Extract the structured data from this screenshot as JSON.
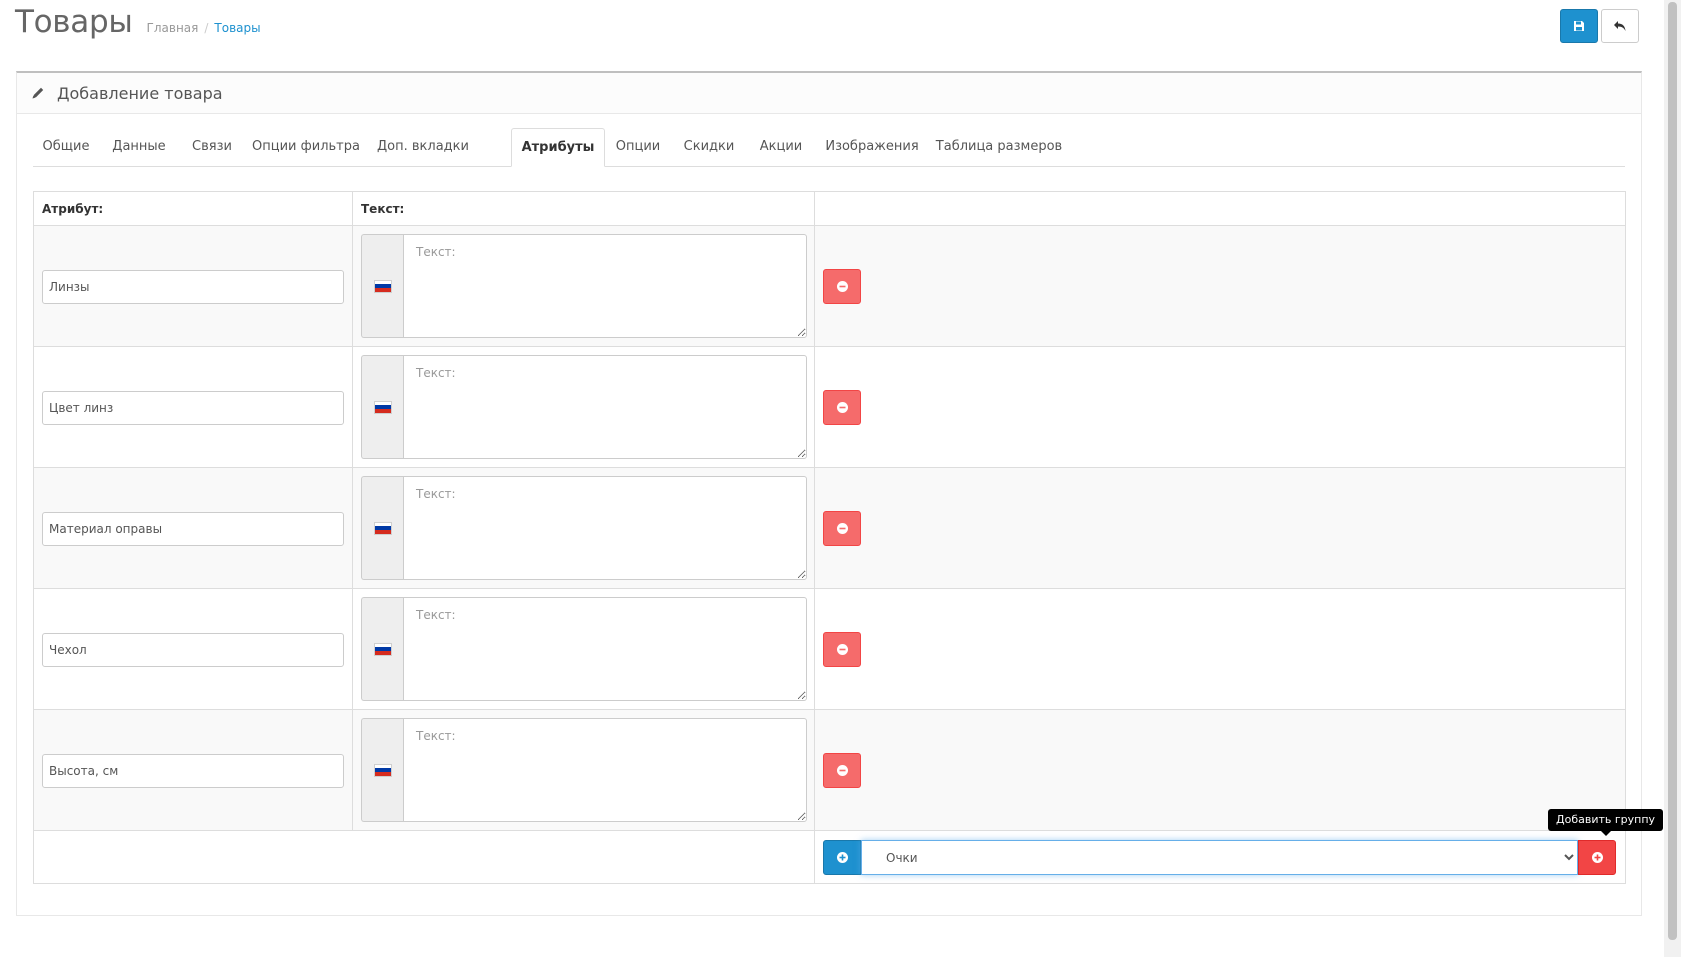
{
  "header": {
    "title": "Товары",
    "breadcrumb": [
      "Главная",
      "Товары"
    ]
  },
  "panel": {
    "title": "Добавление товара"
  },
  "tabs": [
    "Общие",
    "Данные",
    "Связи",
    "Опции фильтра",
    "Доп. вкладки",
    "Атрибуты",
    "Опции",
    "Скидки",
    "Акции",
    "Изображения",
    "Таблица размеров"
  ],
  "active_tab": "Атрибуты",
  "table": {
    "headers": [
      "Атрибут:",
      "Текст:",
      ""
    ],
    "text_placeholder": "Текст:",
    "rows": [
      {
        "attribute": "Линзы",
        "text": ""
      },
      {
        "attribute": "Цвет линз",
        "text": ""
      },
      {
        "attribute": "Материал оправы",
        "text": ""
      },
      {
        "attribute": "Чехол",
        "text": ""
      },
      {
        "attribute": "Высота, см",
        "text": ""
      }
    ]
  },
  "group_select": {
    "selected": "Очки"
  },
  "tooltip": {
    "text": "Добавить группу"
  },
  "colors": {
    "primary": "#1e91cf",
    "danger": "#f56b6b",
    "danger_strong": "#f24545",
    "flag": [
      "#ffffff",
      "#0039a6",
      "#d52b1e"
    ]
  },
  "icons": {
    "save": "save-icon",
    "back": "reply-icon",
    "panel": "pencil-icon",
    "remove": "minus-circle-icon",
    "add": "plus-circle-icon"
  }
}
